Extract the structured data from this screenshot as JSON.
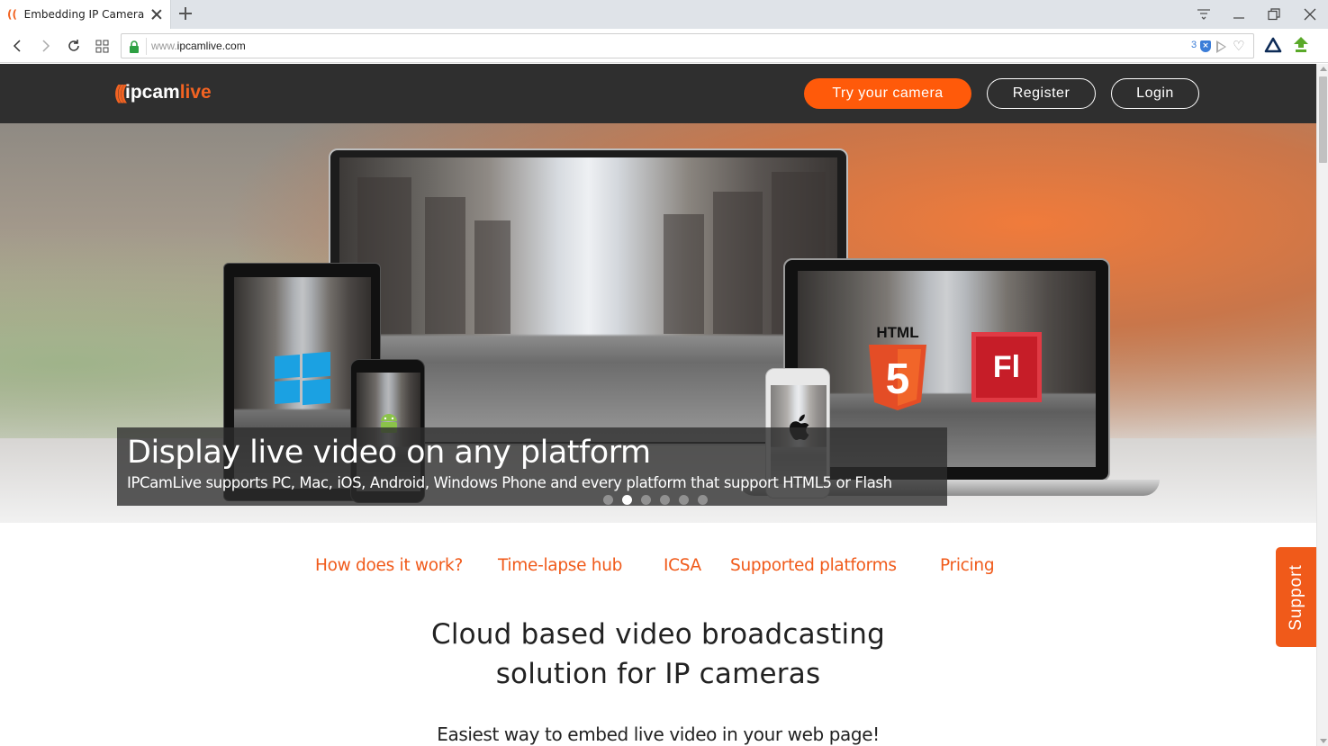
{
  "browser": {
    "tab_title": "Embedding IP Camera Live",
    "url_prefix": "www.",
    "url_domain": "ipcamlive.com",
    "blocked_count": "3"
  },
  "header": {
    "logo_prefix": "ipcam",
    "logo_accent": "live",
    "try_button": "Try your camera",
    "register_button": "Register",
    "login_button": "Login"
  },
  "hero": {
    "title": "Display live video on any platform",
    "subtitle": "IPCamLive supports PC, Mac, iOS, Android, Windows Phone and every platform that support HTML5 or Flash",
    "html5_label": "HTML",
    "html5_number": "5",
    "flash_label": "Fl",
    "slide_count": 6,
    "active_slide": 2
  },
  "menu": {
    "items": [
      {
        "label": "How does it work?"
      },
      {
        "label": "Time-lapse hub"
      },
      {
        "label": "ICSA"
      },
      {
        "label": "Supported platforms"
      },
      {
        "label": "Pricing"
      }
    ]
  },
  "content": {
    "headline_line1": "Cloud based video broadcasting",
    "headline_line2": "solution for IP cameras",
    "tagline": "Easiest way to embed live video in your web page!"
  },
  "support": {
    "label": "Support"
  },
  "colors": {
    "accent": "#f05a1a",
    "header_bg": "#2f2f2f",
    "button_orange": "#ff5a0a"
  }
}
